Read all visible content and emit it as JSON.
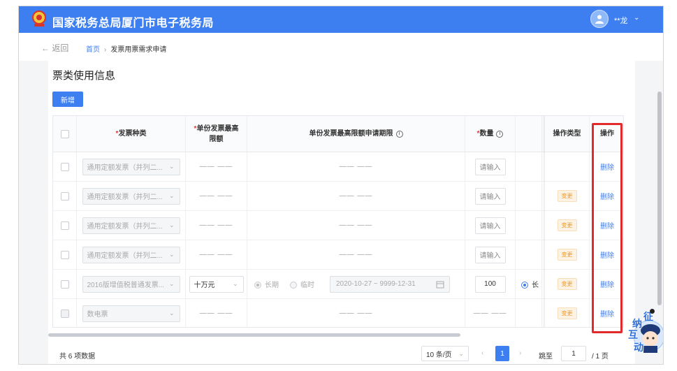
{
  "header": {
    "brand": "国家税务总局厦门市电子税务局",
    "user_name": "**龙",
    "user_caret": "⌄"
  },
  "nav": {
    "back": "← 返回",
    "breadcrumb_home": "首页",
    "breadcrumb_sep": "›",
    "breadcrumb_current": "发票用票需求申请"
  },
  "section": {
    "title": "票类使用信息",
    "add_label": "新增"
  },
  "table": {
    "headers": {
      "type": "发票种类",
      "limit": "单份发票最高限额",
      "period": "单份发票最高限额申请期限",
      "qty": "数量",
      "op_type": "操作类型",
      "action": "操作"
    },
    "dash": "—— ——",
    "rows": [
      {
        "type": "通用定额发票（并列二...",
        "qty_placeholder": "请输入",
        "tag": "",
        "action": "删除"
      },
      {
        "type": "通用定额发票（并列二...",
        "qty_placeholder": "请输入",
        "tag": "变更",
        "action": "删除"
      },
      {
        "type": "通用定额发票（并列二...",
        "qty_placeholder": "请输入",
        "tag": "变更",
        "action": "删除"
      },
      {
        "type": "通用定额发票（并列二...",
        "qty_placeholder": "请输入",
        "tag": "变更",
        "action": "删除"
      },
      {
        "type": "2016版增值税普通发票...",
        "limit": "十万元",
        "radio_long": "长期",
        "radio_temp": "临时",
        "daterange": "2020-10-27  ~  9999-12-31",
        "qty": "100",
        "extra": "长",
        "tag": "变更",
        "action": "删除"
      },
      {
        "type": "数电票",
        "tag": "变更",
        "action": "删除"
      }
    ]
  },
  "pagination": {
    "total": "共 6 项数据",
    "page_size": "10 条/页",
    "current": "1",
    "jump_label": "跳至",
    "jump_value": "1",
    "page_total": "/ 1 页"
  },
  "mascot": {
    "chars": [
      "征",
      "纳",
      "互",
      "动"
    ]
  },
  "colors": {
    "primary": "#3d7ff0",
    "highlight": "#e22a2a",
    "tag_orange": "#f0972b"
  }
}
